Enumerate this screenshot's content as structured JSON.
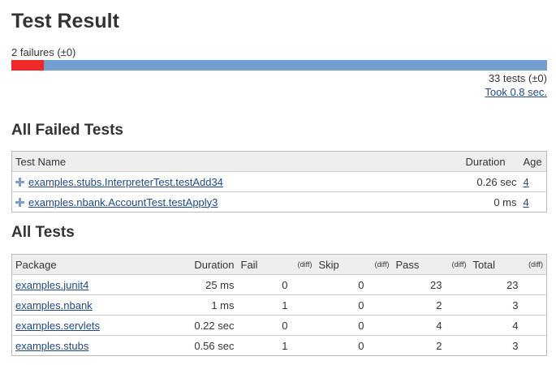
{
  "title": "Test Result",
  "summary": {
    "failures": "2 failures (±0)",
    "fail_count": 2,
    "total_count": 33,
    "tests": "33 tests (±0)",
    "took": "Took 0.8 sec."
  },
  "failed": {
    "heading": "All Failed Tests",
    "headers": [
      "Test Name",
      "Duration",
      "Age"
    ],
    "rows": [
      {
        "name": "examples.stubs.InterpreterTest.testAdd34",
        "duration": "0.26 sec",
        "age": "4"
      },
      {
        "name": "examples.nbank.AccountTest.testApply3",
        "duration": "0 ms",
        "age": "4"
      }
    ]
  },
  "all": {
    "heading": "All Tests",
    "headers": {
      "package": "Package",
      "duration": "Duration",
      "fail": "Fail",
      "skip": "Skip",
      "pass": "Pass",
      "total": "Total",
      "diff": "(diff)"
    },
    "rows": [
      {
        "package": "examples.junit4",
        "duration": "25 ms",
        "fail": "0",
        "skip": "0",
        "pass": "23",
        "total": "23"
      },
      {
        "package": "examples.nbank",
        "duration": "1 ms",
        "fail": "1",
        "skip": "0",
        "pass": "2",
        "total": "3"
      },
      {
        "package": "examples.servlets",
        "duration": "0.22 sec",
        "fail": "0",
        "skip": "0",
        "pass": "4",
        "total": "4"
      },
      {
        "package": "examples.stubs",
        "duration": "0.56 sec",
        "fail": "1",
        "skip": "0",
        "pass": "2",
        "total": "3"
      }
    ]
  }
}
